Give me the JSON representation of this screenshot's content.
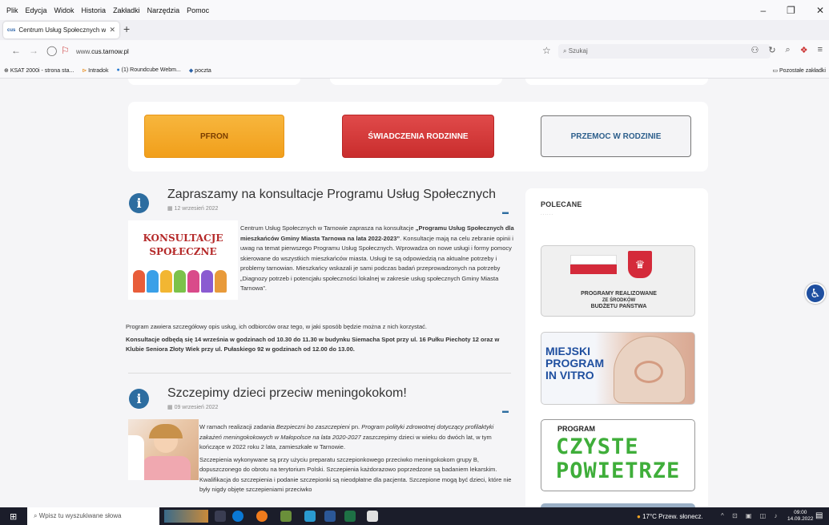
{
  "browser": {
    "menu": [
      "Plik",
      "Edycja",
      "Widok",
      "Historia",
      "Zakładki",
      "Narzędzia",
      "Pomoc"
    ],
    "tab_title": "Centrum Usług Społecznych w",
    "tab_favicon": "cus",
    "url_prefix": "www.",
    "url_domain": "cus.tarnow.pl",
    "search_placeholder": "Szukaj",
    "bookmarks": [
      "KSAT 2000i - strona sta...",
      "Intradok",
      "(1) Roundcube Webm...",
      "poczta"
    ],
    "other_bookmarks": "Pozostałe zakładki"
  },
  "buttons": {
    "pfron": "PFRON",
    "swiadczenia": "ŚWIADCZENIA RODZINNE",
    "przemoc": "PRZEMOC W RODZINIE"
  },
  "articles": [
    {
      "title": "Zapraszamy na konsultacje Programu Usług Społecznych",
      "date": "12 wrzesień 2022",
      "image_text1": "KONSULTACJE",
      "image_text2": "SPOŁECZNE",
      "p1_a": "Centrum Usług Społecznych w Tarnowie zaprasza na konsultacje ",
      "p1_b": "„Programu Usług Społecznych dla mieszkańców Gminy Miasta Tarnowa na lata 2022-2023”",
      "p1_c": ". Konsultacje mają na celu zebranie opinii i uwag na temat pierwszego Programu Usług Społecznych. Wprowadza on nowe usługi i formy pomocy skierowane do wszystkich mieszkańców miasta. Usługi te są odpowiedzią na aktualne potrzeby i problemy tarnowian. Mieszkańcy wskazali je sami podczas badań przeprowadzonych na potrzeby „Diagnozy potrzeb i potencjału społeczności lokalnej w zakresie usług społecznych Gminy Miasta Tarnowa”.",
      "p2": "Program zawiera szczegółowy opis usług, ich odbiorców oraz tego, w jaki sposób będzie można z nich korzystać.",
      "p3": "Konsultacje odbędą się 14 września w godzinach od 10.30 do 11.30 w budynku Siemacha Spot przy ul. 16 Pułku Piechoty 12 oraz w Klubie Seniora Złoty Wiek przy ul. Pułaskiego 92 w godzinach od 12.00 do 13.00."
    },
    {
      "title": "Szczepimy dzieci przeciw meningokokom!",
      "date": "09 wrzesień 2022",
      "p1_a": "W ramach realizacji zadania ",
      "p1_b": "Bezpieczni bo zaszczepieni",
      "p1_c": " pn. ",
      "p1_d": "Program polityki zdrowotnej dotyczący profilaktyki zakażeń meningokokowych w Małopolsce na lata 2020-2027",
      "p1_e": " zaszczepimy dzieci w wieku do dwóch lat, w tym kończące w 2022 roku 2 lata, zamieszkałe w Tarnowie.",
      "p2": "Szczepienia wykonywane są przy użyciu preparatu szczepionkowego przeciwko meningokokom grupy B, dopuszczonego do obrotu na terytorium Polski. Szczepienia każdorazowo poprzedzone są badaniem lekarskim. Kwalifikacja do szczepienia i podanie szczepionki są nieodpłatne dla pacjenta. Szczepione mogą być dzieci, które nie były nigdy objęte szczepieniami przeciwko"
    }
  ],
  "sidebar": {
    "heading": "POLECANE",
    "promo1_l1": "PROGRAMY REALIZOWANE",
    "promo1_l2": "ZE ŚRODKÓW",
    "promo1_l3": "BUDŻETU PAŃSTWA",
    "promo2_l1": "MIEJSKI",
    "promo2_l2": "PROGRAM",
    "promo2_l3": "IN VITRO",
    "promo3_l1": "PROGRAM",
    "promo3_l2": "CZYSTE",
    "promo3_l3": "POWIETRZE"
  },
  "taskbar": {
    "search_placeholder": "Wpisz tu wyszukiwane słowa",
    "weather": "17°C  Przew. słonecz.",
    "time": "09:00",
    "date": "14.09.2022"
  },
  "colors": {
    "pfron": "#f5a623",
    "swiadczenia": "#d63a3a",
    "link_blue": "#2d6da0"
  }
}
